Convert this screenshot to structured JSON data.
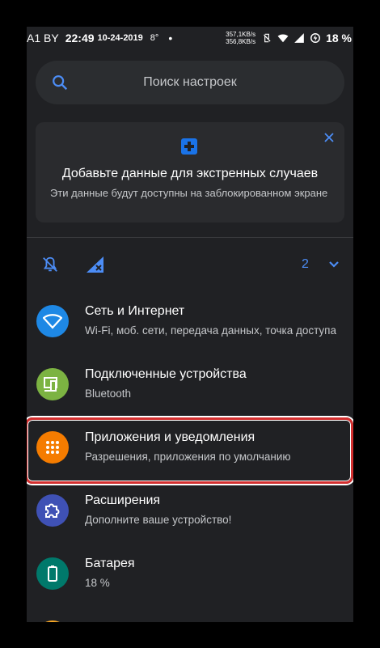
{
  "status_bar": {
    "carrier": "A1 BY",
    "time": "22:49",
    "date": "10-24-2019",
    "temp": "8°",
    "dot": "•",
    "speed_up": "357,1KB/s",
    "speed_down": "356,8KB/s",
    "battery": "18 %"
  },
  "search": {
    "placeholder": "Поиск настроек"
  },
  "emergency_card": {
    "title": "Добавьте данные для экстренных случаев",
    "subtitle": "Эти данные будут доступны на заблокированном экране"
  },
  "conditions": {
    "count": "2"
  },
  "settings": [
    {
      "label": "Сеть и Интернет",
      "sub": "Wi-Fi, моб. сети, передача данных, точка доступа",
      "icon": "wifi-icon",
      "color": "#1e88e5"
    },
    {
      "label": "Подключенные устройства",
      "sub": "Bluetooth",
      "icon": "devices-icon",
      "color": "#7cb342"
    },
    {
      "label": "Приложения и уведомления",
      "sub": "Разрешения, приложения по умолчанию",
      "icon": "apps-icon",
      "color": "#f57c00"
    },
    {
      "label": "Расширения",
      "sub": "Дополните ваше устройство!",
      "icon": "puzzle-icon",
      "color": "#3f51b5"
    },
    {
      "label": "Батарея",
      "sub": "18 %",
      "icon": "battery-icon",
      "color": "#00796b"
    }
  ],
  "colors": {
    "background": "#202124",
    "accent": "#4c8df6",
    "highlight_border": "#d32f2f"
  }
}
